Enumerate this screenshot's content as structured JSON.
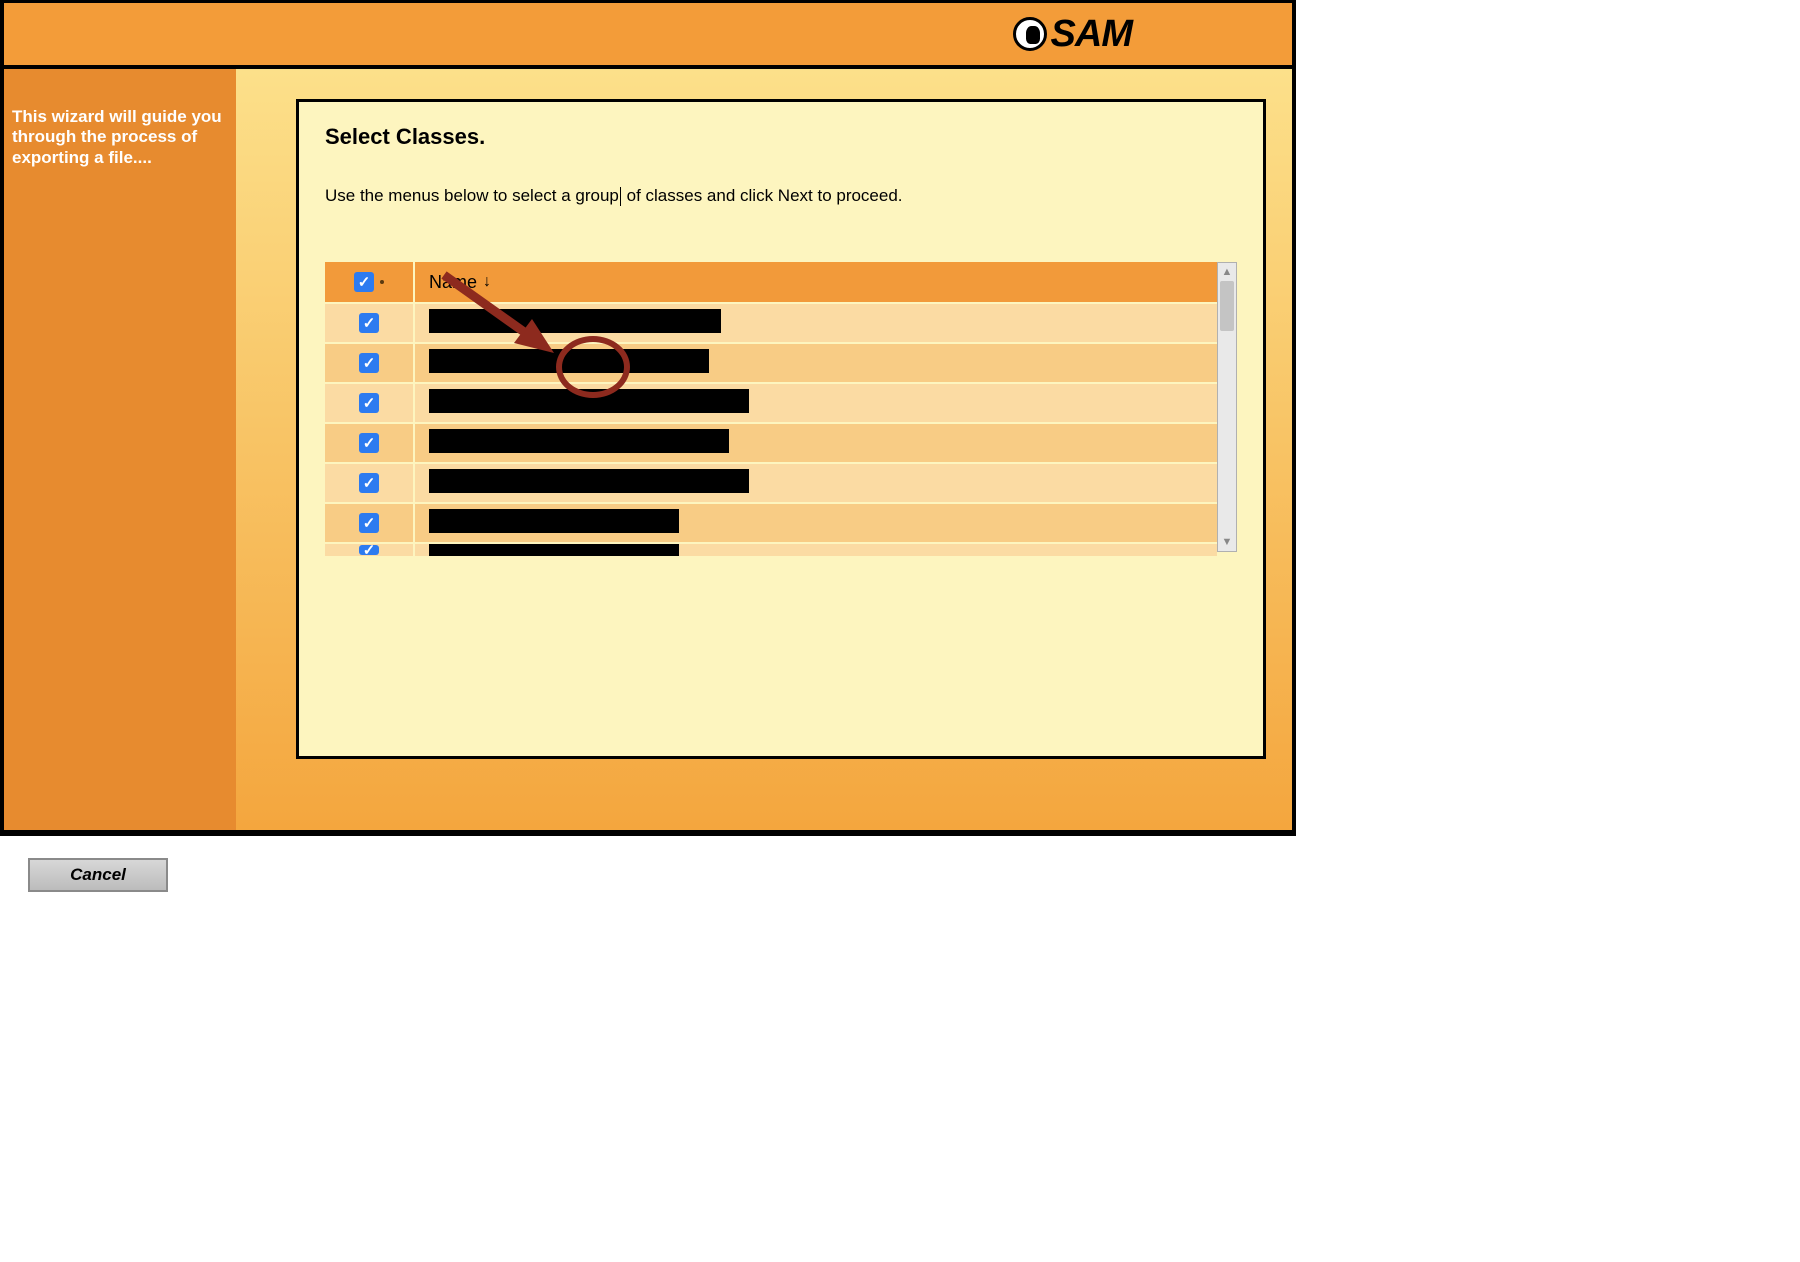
{
  "app_name": "SAM",
  "sidebar": {
    "wizard_text": "This wizard will guide you through the process of exporting a file...."
  },
  "panel": {
    "title": "Select Classes.",
    "instruction_pre": "Use the menus below to select a group",
    "instruction_post": " of classes and click Next to proceed."
  },
  "table": {
    "header": {
      "name_label": "Name",
      "sort_indicator": "↓",
      "select_all_checked": true
    },
    "rows": [
      {
        "checked": true,
        "redact_width": 292
      },
      {
        "checked": true,
        "redact_width": 280
      },
      {
        "checked": true,
        "redact_width": 320
      },
      {
        "checked": true,
        "redact_width": 300
      },
      {
        "checked": true,
        "redact_width": 320
      },
      {
        "checked": true,
        "redact_width": 250
      },
      {
        "checked": true,
        "redact_width": 250,
        "partial": true
      }
    ]
  },
  "footer": {
    "cancel_label": "Cancel"
  }
}
